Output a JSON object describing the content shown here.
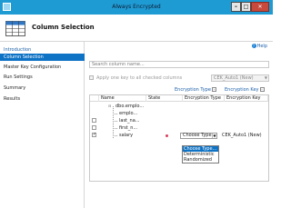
{
  "window": {
    "title": "Always Encrypted"
  },
  "page": {
    "title": "Column Selection"
  },
  "sidebar": {
    "items": [
      {
        "label": "Introduction"
      },
      {
        "label": "Column Selection"
      },
      {
        "label": "Master Key Configuration"
      },
      {
        "label": "Run Settings"
      },
      {
        "label": "Summary"
      },
      {
        "label": "Results"
      }
    ],
    "active_index": 1
  },
  "help": {
    "label": "Help"
  },
  "search": {
    "placeholder": "Search column name..."
  },
  "apply_all": {
    "label": "Apply one key to all checked columns",
    "checked": false,
    "key_value": "CEK_Auto1 (New)"
  },
  "encryption_type_header": "Encryption Type",
  "encryption_key_header": "Encryption Key",
  "grid": {
    "columns": [
      "Name",
      "State",
      "Encryption Type",
      "Encryption Key"
    ],
    "rows": [
      {
        "name": "dbo.emplo...",
        "level": 0,
        "checkbox": false,
        "expander": "⊟"
      },
      {
        "name": "emplo...",
        "level": 1,
        "checkbox": false
      },
      {
        "name": "last_na...",
        "level": 1,
        "checkbox": true,
        "checked": false
      },
      {
        "name": "first_n...",
        "level": 1,
        "checkbox": true,
        "checked": false
      },
      {
        "name": "salary",
        "level": 1,
        "checkbox": true,
        "checked": true,
        "state_icon": "warning-dot-icon",
        "encryption_type": "Choose Type...",
        "encryption_key": "CEK_Auto1 (New)"
      }
    ]
  },
  "dropdown": {
    "options": [
      "Choose Type...",
      "Deterministic",
      "Randomized"
    ],
    "selected_index": 0
  },
  "colors": {
    "titlebar": "#1f9bd4",
    "accent": "#0e72c5",
    "link": "#1a5fa8",
    "state_icon": "#d8405a"
  }
}
